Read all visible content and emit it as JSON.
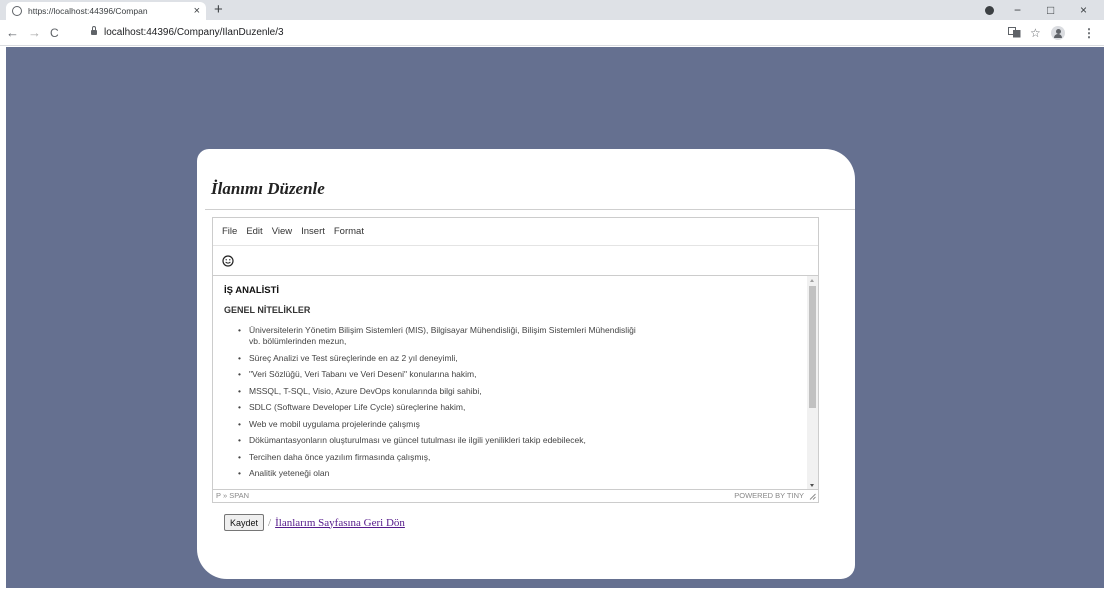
{
  "browser": {
    "tab_title": "https://localhost:44396/Compan",
    "tab_close": "×",
    "new_tab": "+",
    "url": "localhost:44396/Company/IlanDuzenle/3",
    "nav": {
      "back": "←",
      "forward": "→",
      "reload": "C"
    },
    "window_controls": {
      "minimize": "−",
      "maximize": "□",
      "close": "×"
    },
    "toolbar_icons": {
      "star": "☆",
      "menu": "⋮"
    }
  },
  "page": {
    "title": "İlanımı Düzenle",
    "editor": {
      "menu": [
        "File",
        "Edit",
        "View",
        "Insert",
        "Format"
      ],
      "content": {
        "heading": "İŞ ANALİSTİ",
        "subheading": "GENEL NİTELİKLER",
        "items": [
          "Üniversitelerin Yönetim Bilişim Sistemleri (MIS), Bilgisayar Mühendisliği, Bilişim Sistemleri Mühendisliği vb. bölümlerinden mezun,",
          "Süreç Analizi ve  Test süreçlerinde en az 2 yıl deneyimli,",
          "\"Veri Sözlüğü, Veri Tabanı ve Veri Deseni\" konularına hakim,",
          "MSSQL, T-SQL, Visio, Azure DevOps konularında bilgi sahibi,",
          "SDLC (Software Developer Life Cycle) süreçlerine hakim,",
          "Web ve  mobil uygulama projelerinde çalışmış",
          "Dökümantasyonların oluşturulması ve güncel tutulması ile ilgili yenilikleri takip edebilecek,",
          "Tercihen daha önce yazılım firmasında çalışmış,",
          "Analitik yeteneği olan"
        ]
      },
      "status_path": "P » SPAN",
      "powered_by": "POWERED BY TINY"
    },
    "save_button": "Kaydet",
    "separator": "/",
    "back_link": "İlanlarım Sayfasına Geri Dön"
  },
  "colors": {
    "page_background": "#657090",
    "link": "#551a8b"
  }
}
